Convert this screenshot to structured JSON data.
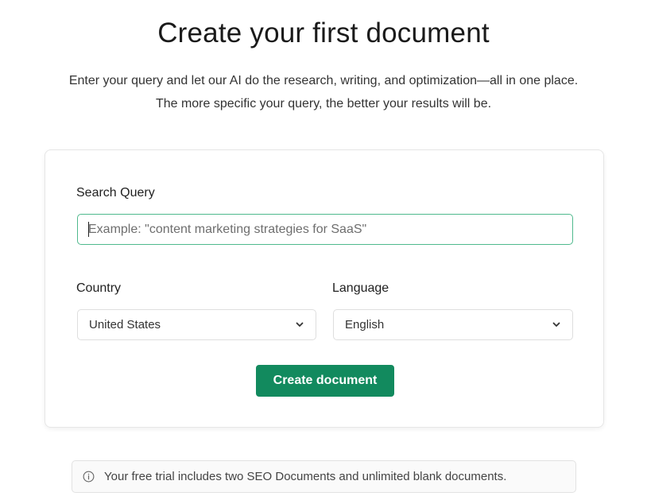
{
  "header": {
    "title": "Create your first document",
    "subtitle_line1": "Enter your query and let our AI do the research, writing, and optimization—all in one place.",
    "subtitle_line2": "The more specific your query, the better your results will be."
  },
  "form": {
    "query_label": "Search Query",
    "query_value": "",
    "query_placeholder": "Example: \"content marketing strategies for SaaS\"",
    "country_label": "Country",
    "country_value": "United States",
    "language_label": "Language",
    "language_value": "English",
    "submit_label": "Create document"
  },
  "notice": {
    "icon": "info-icon",
    "text": "Your free trial includes two SEO Documents and unlimited blank documents."
  },
  "colors": {
    "primary_button": "#128a5e",
    "focus_border": "#4fb98d"
  }
}
